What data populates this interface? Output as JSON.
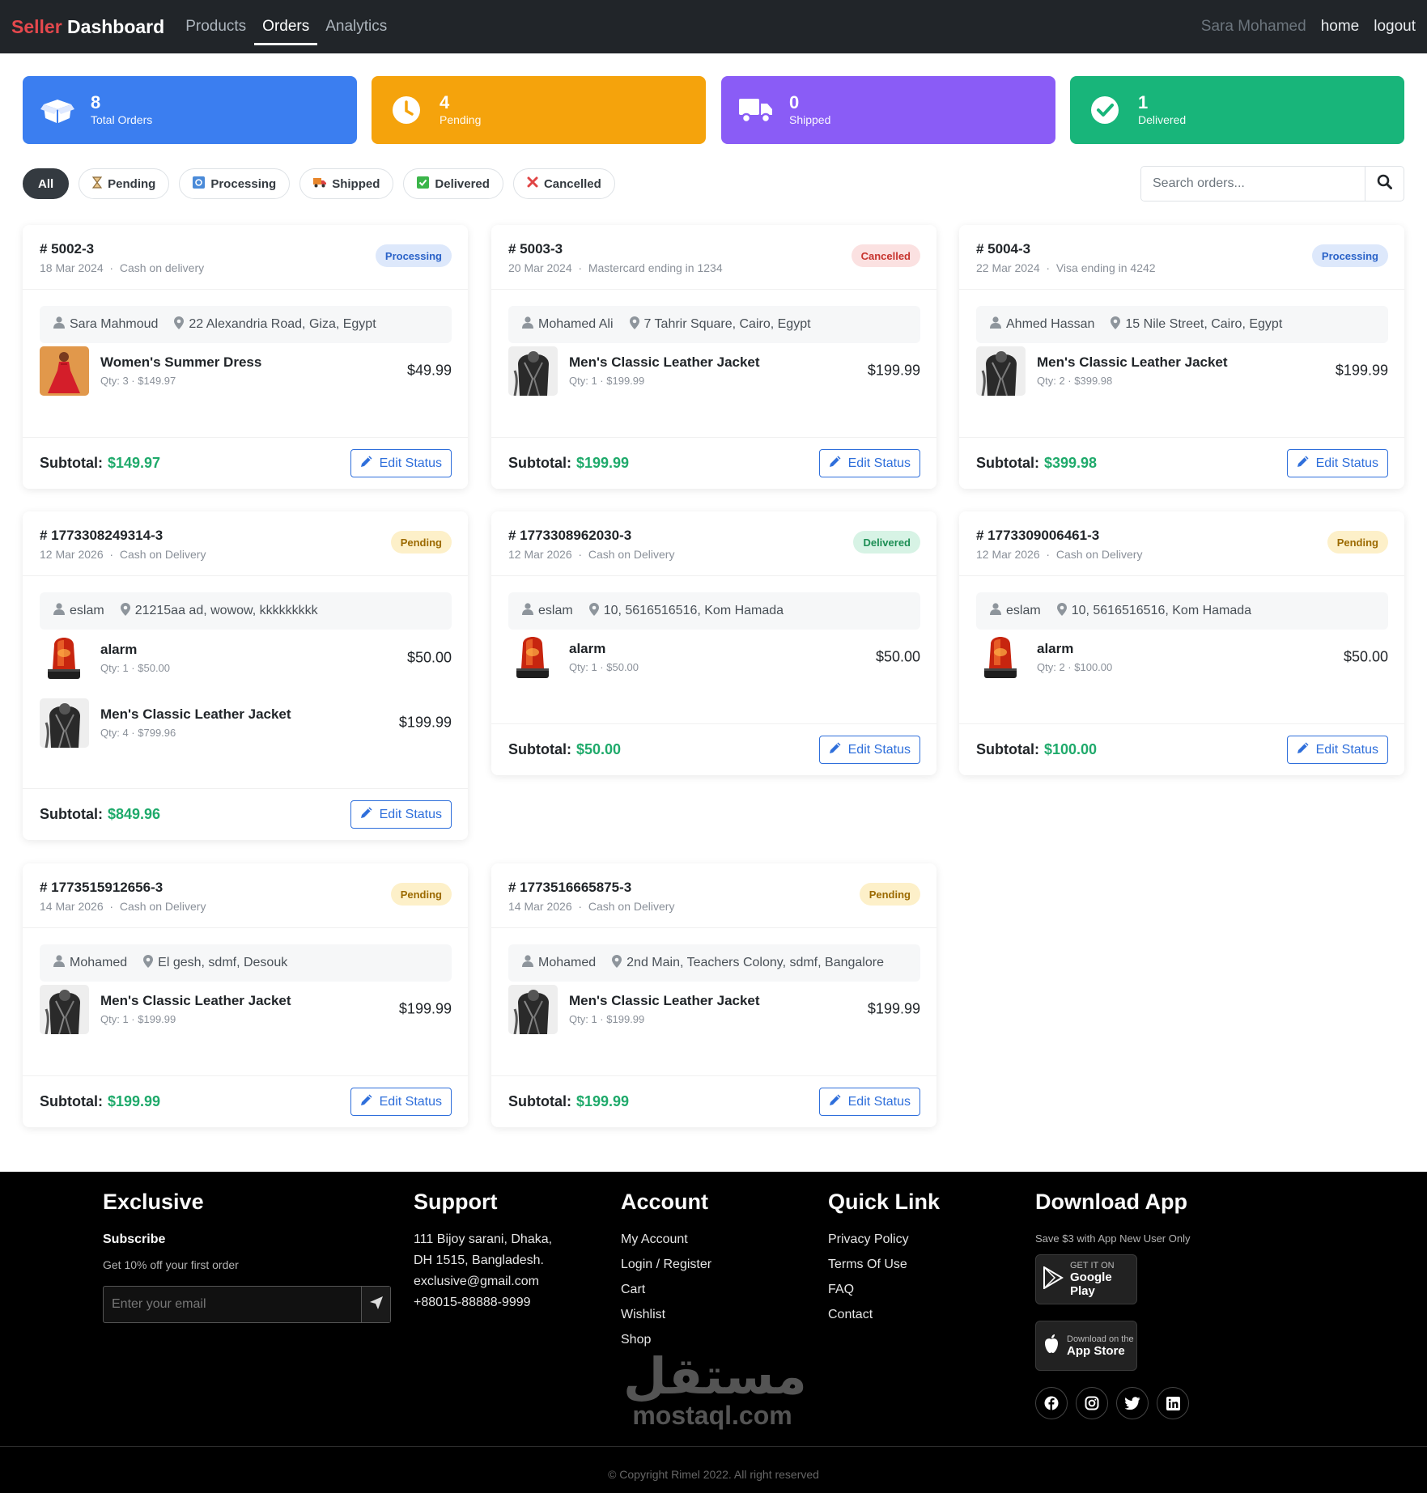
{
  "nav": {
    "brand_red": "Seller",
    "brand_white": "Dashboard",
    "links": [
      "Products",
      "Orders",
      "Analytics"
    ],
    "active": "Orders",
    "user": "Sara Mohamed",
    "home": "home",
    "logout": "logout"
  },
  "stats": [
    {
      "value": "8",
      "label": "Total Orders",
      "color": "#3b7ef0",
      "icon": "box-open-icon"
    },
    {
      "value": "4",
      "label": "Pending",
      "color": "#f5a30c",
      "icon": "clock-icon"
    },
    {
      "value": "0",
      "label": "Shipped",
      "color": "#8a5cf6",
      "icon": "truck-icon"
    },
    {
      "value": "1",
      "label": "Delivered",
      "color": "#18b57a",
      "icon": "check-circle-icon"
    }
  ],
  "filters": [
    {
      "label": "All",
      "icon": ""
    },
    {
      "label": "Pending",
      "icon": "hourglass-icon"
    },
    {
      "label": "Processing",
      "icon": "refresh-icon"
    },
    {
      "label": "Shipped",
      "icon": "truck-icon"
    },
    {
      "label": "Delivered",
      "icon": "check-box-icon"
    },
    {
      "label": "Cancelled",
      "icon": "cross-icon"
    }
  ],
  "search": {
    "placeholder": "Search orders..."
  },
  "subtotal_label": "Subtotal:",
  "edit_label": "Edit Status",
  "orders": [
    {
      "id": "# 5002-3",
      "date": "18 Mar 2024",
      "payment": "Cash on delivery",
      "status": "Processing",
      "customer": "Sara Mahmoud",
      "address": "22 Alexandria Road, Giza, Egypt",
      "items": [
        {
          "name": "Women's Summer Dress",
          "qty": "Qty: 3",
          "total": "$149.97",
          "price": "$49.99",
          "thumb": "dress"
        }
      ],
      "subtotal": "$149.97"
    },
    {
      "id": "# 5003-3",
      "date": "20 Mar 2024",
      "payment": "Mastercard ending in 1234",
      "status": "Cancelled",
      "customer": "Mohamed Ali",
      "address": "7 Tahrir Square, Cairo, Egypt",
      "items": [
        {
          "name": "Men's Classic Leather Jacket",
          "qty": "Qty: 1",
          "total": "$199.99",
          "price": "$199.99",
          "thumb": "jacket"
        }
      ],
      "subtotal": "$199.99"
    },
    {
      "id": "# 5004-3",
      "date": "22 Mar 2024",
      "payment": "Visa ending in 4242",
      "status": "Processing",
      "customer": "Ahmed Hassan",
      "address": "15 Nile Street, Cairo, Egypt",
      "items": [
        {
          "name": "Men's Classic Leather Jacket",
          "qty": "Qty: 2",
          "total": "$399.98",
          "price": "$199.99",
          "thumb": "jacket"
        }
      ],
      "subtotal": "$399.98"
    },
    {
      "id": "# 1773308249314-3",
      "date": "12 Mar 2026",
      "payment": "Cash on Delivery",
      "status": "Pending",
      "customer": "eslam",
      "address": "21215aa ad, wowow, kkkkkkkkk",
      "items": [
        {
          "name": "alarm",
          "qty": "Qty: 1",
          "total": "$50.00",
          "price": "$50.00",
          "thumb": "alarm"
        },
        {
          "name": "Men's Classic Leather Jacket",
          "qty": "Qty: 4",
          "total": "$799.96",
          "price": "$199.99",
          "thumb": "jacket"
        }
      ],
      "subtotal": "$849.96"
    },
    {
      "id": "# 1773308962030-3",
      "date": "12 Mar 2026",
      "payment": "Cash on Delivery",
      "status": "Delivered",
      "customer": "eslam",
      "address": "10, 5616516516, Kom Hamada",
      "items": [
        {
          "name": "alarm",
          "qty": "Qty: 1",
          "total": "$50.00",
          "price": "$50.00",
          "thumb": "alarm"
        }
      ],
      "subtotal": "$50.00"
    },
    {
      "id": "# 1773309006461-3",
      "date": "12 Mar 2026",
      "payment": "Cash on Delivery",
      "status": "Pending",
      "customer": "eslam",
      "address": "10, 5616516516, Kom Hamada",
      "items": [
        {
          "name": "alarm",
          "qty": "Qty: 2",
          "total": "$100.00",
          "price": "$50.00",
          "thumb": "alarm"
        }
      ],
      "subtotal": "$100.00"
    },
    {
      "id": "# 1773515912656-3",
      "date": "14 Mar 2026",
      "payment": "Cash on Delivery",
      "status": "Pending",
      "customer": "Mohamed",
      "address": "El gesh, sdmf, Desouk",
      "items": [
        {
          "name": "Men's Classic Leather Jacket",
          "qty": "Qty: 1",
          "total": "$199.99",
          "price": "$199.99",
          "thumb": "jacket"
        }
      ],
      "subtotal": "$199.99"
    },
    {
      "id": "# 1773516665875-3",
      "date": "14 Mar 2026",
      "payment": "Cash on Delivery",
      "status": "Pending",
      "customer": "Mohamed",
      "address": "2nd Main, Teachers Colony, sdmf, Bangalore",
      "items": [
        {
          "name": "Men's Classic Leather Jacket",
          "qty": "Qty: 1",
          "total": "$199.99",
          "price": "$199.99",
          "thumb": "jacket"
        }
      ],
      "subtotal": "$199.99"
    }
  ],
  "footer": {
    "exclusive": {
      "title": "Exclusive",
      "subtitle": "Subscribe",
      "text": "Get 10% off your first order",
      "placeholder": "Enter your email"
    },
    "support": {
      "title": "Support",
      "lines": [
        "111 Bijoy sarani, Dhaka,",
        "DH 1515, Bangladesh.",
        "exclusive@gmail.com",
        "+88015-88888-9999"
      ]
    },
    "account": {
      "title": "Account",
      "links": [
        "My Account",
        "Login / Register",
        "Cart",
        "Wishlist",
        "Shop"
      ]
    },
    "quick": {
      "title": "Quick Link",
      "links": [
        "Privacy Policy",
        "Terms Of Use",
        "FAQ",
        "Contact"
      ]
    },
    "download": {
      "title": "Download App",
      "text": "Save $3 with App New User Only",
      "google_small": "GET IT ON",
      "google_big": "Google Play",
      "apple_small": "Download on the",
      "apple_big": "App Store",
      "socials": [
        "facebook-icon",
        "instagram-icon",
        "twitter-icon",
        "linkedin-icon"
      ]
    },
    "watermark_ar": "مستقل",
    "watermark_lat": "mostaql.com",
    "copyright": "© Copyright Rimel 2022. All right reserved"
  }
}
